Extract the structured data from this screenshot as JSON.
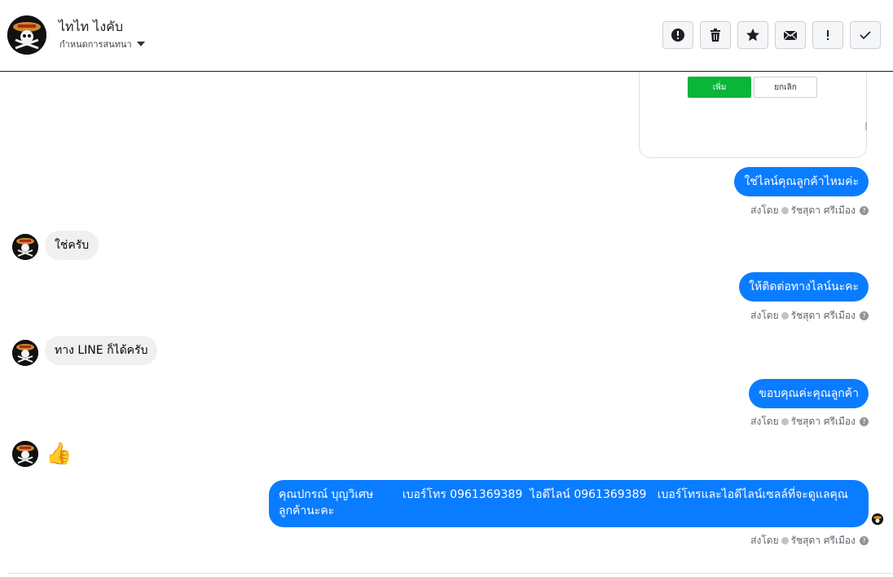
{
  "header": {
    "contact_name": "ไทไท ไงคับ",
    "conversation_settings": "กำหนดการสนทนา",
    "toolbar_icons": [
      "alert-circle-icon",
      "trash-icon",
      "star-icon",
      "envelope-icon",
      "exclamation-icon",
      "check-icon"
    ]
  },
  "card": {
    "add_label": "เพิ่ม",
    "cancel_label": "ยกเลิก"
  },
  "messages": [
    {
      "direction": "out",
      "text": "ใช่ไลน์คุณลูกค้าไหมค่ะ"
    },
    {
      "direction": "in",
      "text": "ใช่ครับ"
    },
    {
      "direction": "out",
      "text": "ให้ติดต่อทางไลน์นะคะ"
    },
    {
      "direction": "in",
      "text": "ทาง LINE ก็ได้ครับ"
    },
    {
      "direction": "out",
      "text": "ขอบคุณค่ะคุณลูกค้า"
    },
    {
      "direction": "in",
      "text": "👍"
    },
    {
      "direction": "out",
      "text": "คุณปกรณ์ บุญวิเศษ        เบอร์โทร 0961369389  ไอดีไลน์ 0961369389   เบอร์โทรและไอดีไลน์เซลล์ที่จะดูแลคุณลูกค้านะคะ"
    }
  ],
  "sent_by": {
    "prefix": "ส่งโดย",
    "agent": "รัชสุดา ศรีเมือง",
    "help": "?"
  },
  "colors": {
    "outgoing_bubble": "#0a7cff",
    "incoming_bubble": "#f0f0f0",
    "add_button": "#0ab539"
  }
}
